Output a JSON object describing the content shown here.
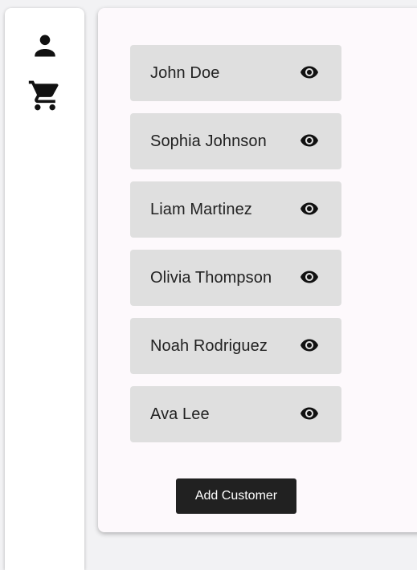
{
  "sidebar": {
    "items": [
      {
        "icon": "person-icon"
      },
      {
        "icon": "shopping-cart-icon"
      }
    ]
  },
  "customers": [
    {
      "name": "John Doe",
      "action_icon": "eye-icon"
    },
    {
      "name": "Sophia Johnson",
      "action_icon": "eye-icon"
    },
    {
      "name": "Liam Martinez",
      "action_icon": "eye-icon"
    },
    {
      "name": "Olivia Thompson",
      "action_icon": "eye-icon"
    },
    {
      "name": "Noah Rodriguez",
      "action_icon": "eye-icon"
    },
    {
      "name": "Ava Lee",
      "action_icon": "eye-icon"
    }
  ],
  "actions": {
    "add_customer_label": "Add Customer"
  },
  "colors": {
    "page_background": "#f2f2f4",
    "card_background": "#fdf9fc",
    "list_item_background": "#dfdfdf",
    "button_background": "#212121",
    "button_text": "#ffffff",
    "icon": "#111111"
  }
}
